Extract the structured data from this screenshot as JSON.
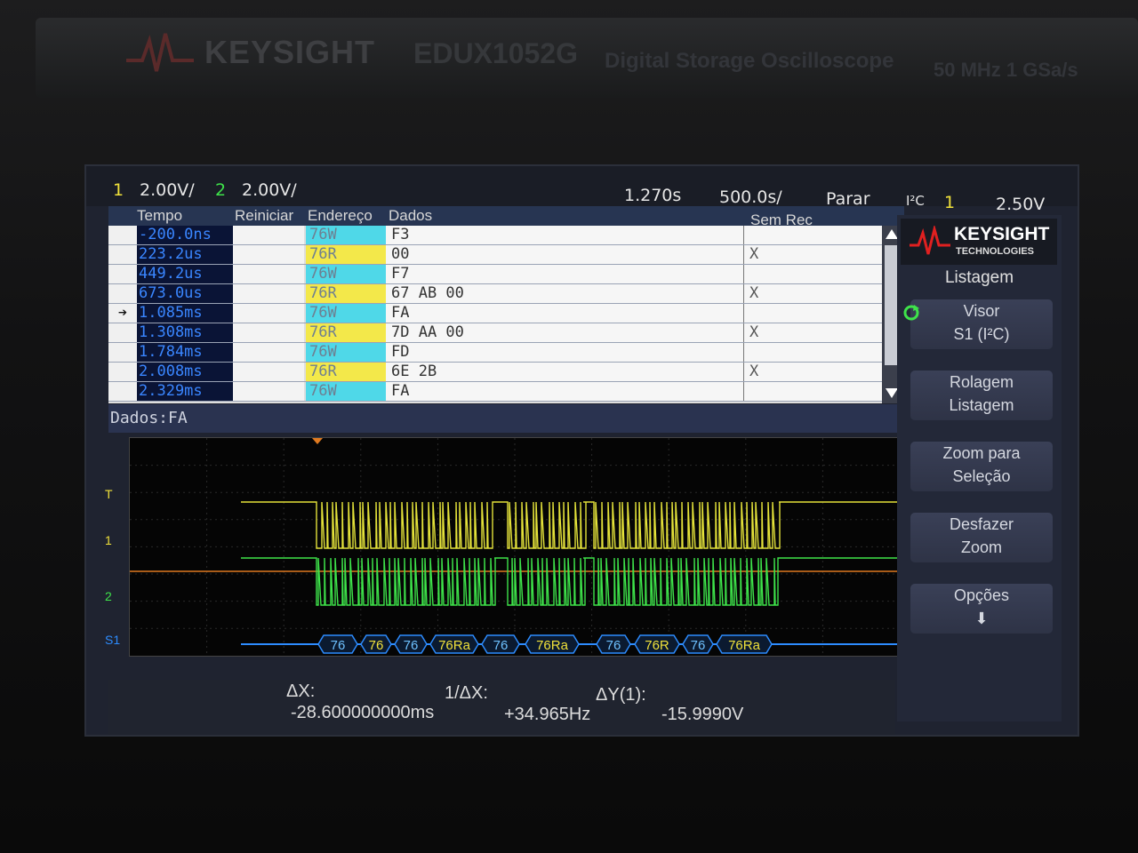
{
  "bezel": {
    "brand": "KEYSIGHT",
    "model": "EDUX1052G",
    "model_desc": "Digital Storage Oscilloscope",
    "spec": "50 MHz  1 GSa/s"
  },
  "status": {
    "ch1_num": "1",
    "ch1_scale": "2.00V/",
    "ch2_num": "2",
    "ch2_scale": "2.00V/",
    "timebase_delay": "1.270s",
    "timebase_scale": "500.0s/",
    "run_state": "Parar",
    "trig_type": "I²C",
    "trig_src": "1",
    "trig_level": "2.50V"
  },
  "table": {
    "headers": {
      "time": "Tempo",
      "reset": "Reiniciar",
      "addr": "Endereço",
      "data": "Dados",
      "nack": "Sem Rec"
    },
    "rows": [
      {
        "mark": "",
        "time": "-200.0ns",
        "reset": "",
        "addr": "76W",
        "data": "F3",
        "nack": ""
      },
      {
        "mark": "",
        "time": "223.2us",
        "reset": "",
        "addr": "76R",
        "data": "00",
        "nack": "X"
      },
      {
        "mark": "",
        "time": "449.2us",
        "reset": "",
        "addr": "76W",
        "data": "F7",
        "nack": ""
      },
      {
        "mark": "",
        "time": "673.0us",
        "reset": "",
        "addr": "76R",
        "data": "67  AB  00",
        "nack": "X"
      },
      {
        "mark": "➔",
        "time": "1.085ms",
        "reset": "",
        "addr": "76W",
        "data": "FA",
        "nack": ""
      },
      {
        "mark": "",
        "time": "1.308ms",
        "reset": "",
        "addr": "76R",
        "data": "7D  AA  00",
        "nack": "X"
      },
      {
        "mark": "",
        "time": "1.784ms",
        "reset": "",
        "addr": "76W",
        "data": "FD",
        "nack": ""
      },
      {
        "mark": "",
        "time": "2.008ms",
        "reset": "",
        "addr": "76R",
        "data": "6E  2B",
        "nack": "X"
      },
      {
        "mark": "",
        "time": "2.329ms",
        "reset": "",
        "addr": "76W",
        "data": "FA",
        "nack": ""
      }
    ],
    "colors": {
      "write": "#4fd8e8",
      "read": "#f3e84a"
    }
  },
  "dados_line": "Dados:FA",
  "waveform": {
    "markers": {
      "trigger": "T",
      "ch1": "1",
      "ch2": "2",
      "serial": "S1"
    },
    "decode_labels": [
      "76",
      "76",
      "76",
      "76Ra",
      "76",
      "76Ra",
      "76",
      "76R",
      "76",
      "76Ra"
    ]
  },
  "measure": {
    "dx_label": "ΔX:",
    "dx_value": "-28.600000000ms",
    "inv_label": "1/ΔX:",
    "inv_value": "+34.965Hz",
    "dy_label": "ΔY(1):",
    "dy_value": "-15.9990V"
  },
  "softkeys": {
    "logo_main": "KEYSIGHT",
    "logo_sub": "TECHNOLOGIES",
    "menu_title": "Listagem",
    "keys": [
      {
        "line1": "Visor",
        "line2": "S1 (I²C)"
      },
      {
        "line1": "Rolagem",
        "line2": "Listagem"
      },
      {
        "line1": "Zoom para",
        "line2": "Seleção"
      },
      {
        "line1": "Desfazer",
        "line2": "Zoom"
      },
      {
        "line1": "Opções",
        "line2": "⬇"
      }
    ]
  }
}
